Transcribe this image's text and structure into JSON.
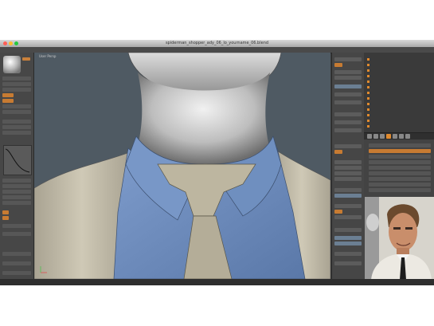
{
  "window": {
    "title": "spiderman_shopper_ady_06_lo_yourname_06.blend",
    "close_color": "#ff5f57",
    "min_color": "#febc2e",
    "max_color": "#28c840"
  },
  "viewport": {
    "label": "User Persp",
    "background_color": "#4f5a63"
  },
  "icons": {
    "brush": "sculpt-brush-icon",
    "axis": "axis-gizmo-icon",
    "reference": "reference-photo"
  },
  "colors": {
    "accent": "#c77b32",
    "shirt": "#6f8fbf",
    "jacket": "#bdb6a0",
    "skin": "#d8d8d8"
  }
}
